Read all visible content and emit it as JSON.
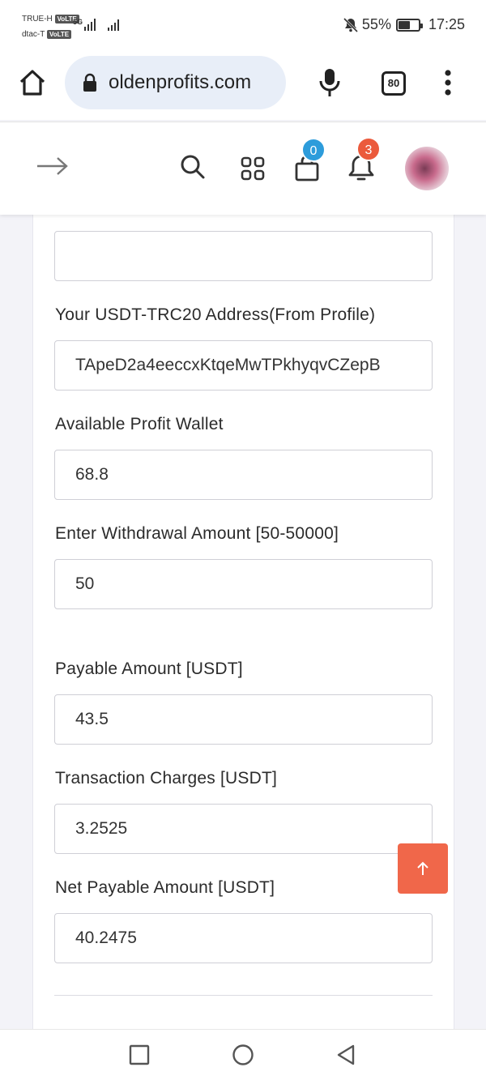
{
  "status_bar": {
    "carrier1": "TRUE-H",
    "carrier2": "dtac-T",
    "volte": "VoLTE",
    "network": "5G",
    "battery": "55%",
    "battery_level": 0.55,
    "time": "17:25"
  },
  "browser": {
    "url": "oldenprofits.com",
    "tab_count": "80"
  },
  "header": {
    "cart_count": "0",
    "notification_count": "3",
    "colors": {
      "cart_badge": "#2d9cdb",
      "notification_badge": "#eb5a3c"
    }
  },
  "form": {
    "first_value": "",
    "address_label": "Your USDT-TRC20 Address(From Profile)",
    "address_value": "TApeD2a4eeccxKtqeMwTPkhyqvCZepB",
    "wallet_label": "Available Profit Wallet",
    "wallet_value": "68.8",
    "amount_label": "Enter Withdrawal Amount [50-50000]",
    "amount_value": "50",
    "payable_label": "Payable Amount [USDT]",
    "payable_value": "43.5",
    "charges_label": "Transaction Charges [USDT]",
    "charges_value": "3.2525",
    "net_label": "Net Payable Amount [USDT]",
    "net_value": "40.2475"
  },
  "colors": {
    "accent": "#f0674a"
  }
}
